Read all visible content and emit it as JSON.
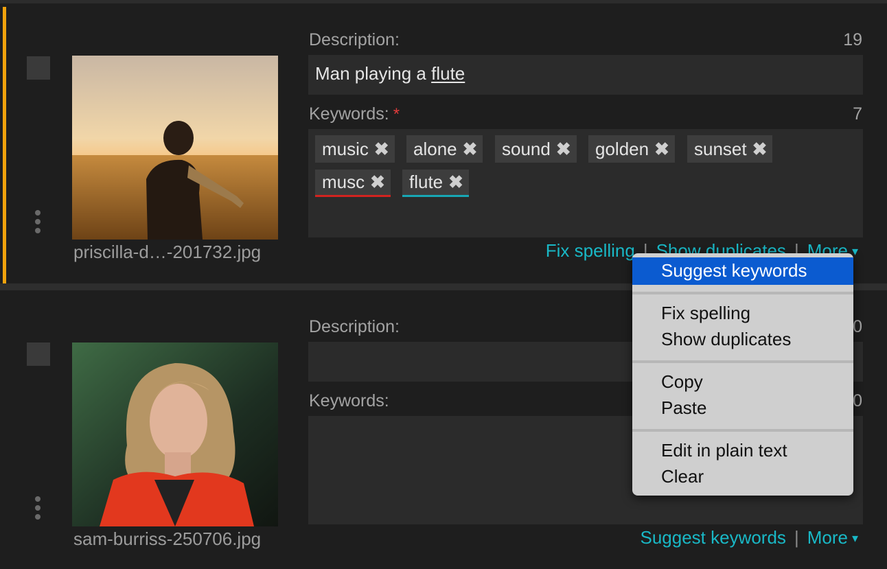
{
  "items": [
    {
      "filename": "priscilla-d…-201732.jpg",
      "description_label": "Description:",
      "description_count": "19",
      "description_text": "Man playing a ",
      "description_misspelled": "flute",
      "keywords_label": "Keywords:",
      "keywords_required": "*",
      "keywords_count": "7",
      "keywords": [
        "music",
        "alone",
        "sound",
        "golden",
        "sunset",
        "musc",
        "flute"
      ],
      "keyword_status": {
        "musc": "spelling-error",
        "flute": "duplicate"
      },
      "links": {
        "fix_spelling": "Fix spelling",
        "show_duplicates": "Show duplicates",
        "more": "More"
      }
    },
    {
      "filename": "sam-burriss-250706.jpg",
      "description_label": "Description:",
      "description_count": "0",
      "description_text": "",
      "keywords_label": "Keywords:",
      "keywords_count": "0",
      "keywords": [],
      "links": {
        "suggest_keywords": "Suggest keywords",
        "more": "More"
      }
    }
  ],
  "separator": "|",
  "caret": "▾",
  "remove_glyph": "✖",
  "context_menu": {
    "highlighted": "Suggest keywords",
    "groups": [
      [
        "Fix spelling",
        "Show duplicates"
      ],
      [
        "Copy",
        "Paste"
      ],
      [
        "Edit in plain text",
        "Clear"
      ]
    ]
  },
  "colors": {
    "accent": "#f0a20c",
    "link": "#19b8c6",
    "error_underline": "#d2231f",
    "duplicate_underline": "#17a7b5",
    "menu_highlight": "#0b5bd0"
  }
}
